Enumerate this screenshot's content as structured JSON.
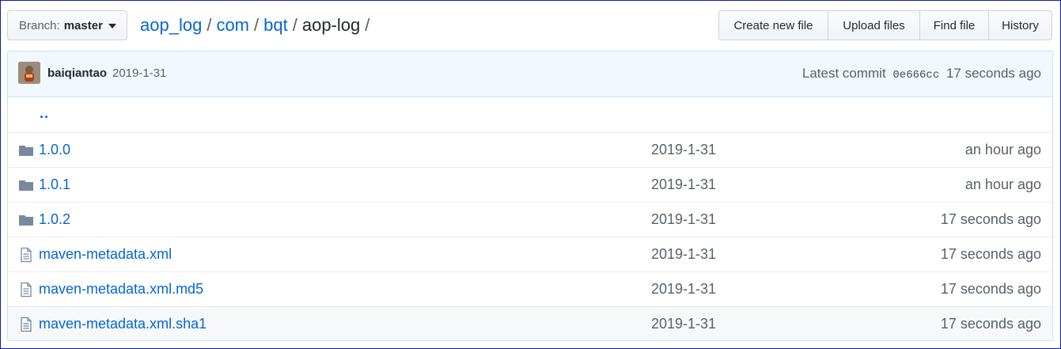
{
  "branch": {
    "prefix": "Branch:",
    "name": "master"
  },
  "breadcrumb": {
    "items": [
      "aop_log",
      "com",
      "bqt"
    ],
    "current": "aop-log",
    "separator": "/"
  },
  "actions": {
    "create_new_file": "Create new file",
    "upload_files": "Upload files",
    "find_file": "Find file",
    "history": "History"
  },
  "commit": {
    "author": "baiqiantao",
    "date": "2019-1-31",
    "latest_label": "Latest commit",
    "sha": "0e666cc",
    "age": "17 seconds ago"
  },
  "parent_link": "..",
  "files": [
    {
      "type": "folder",
      "name": "1.0.0",
      "message": "2019-1-31",
      "age": "an hour ago"
    },
    {
      "type": "folder",
      "name": "1.0.1",
      "message": "2019-1-31",
      "age": "an hour ago"
    },
    {
      "type": "folder",
      "name": "1.0.2",
      "message": "2019-1-31",
      "age": "17 seconds ago"
    },
    {
      "type": "file",
      "name": "maven-metadata.xml",
      "message": "2019-1-31",
      "age": "17 seconds ago"
    },
    {
      "type": "file",
      "name": "maven-metadata.xml.md5",
      "message": "2019-1-31",
      "age": "17 seconds ago"
    },
    {
      "type": "file",
      "name": "maven-metadata.xml.sha1",
      "message": "2019-1-31",
      "age": "17 seconds ago"
    }
  ],
  "colors": {
    "link": "#0366d6",
    "icon": "#79b8ff",
    "folder_icon": "#79889c",
    "commit_bg": "#f1f8ff",
    "frame": "#0a1fa6"
  }
}
